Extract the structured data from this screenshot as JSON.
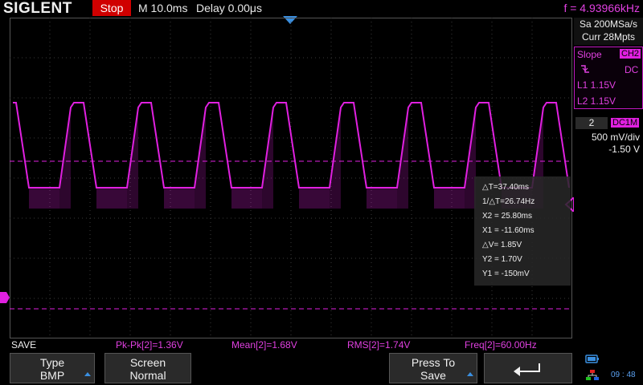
{
  "header": {
    "brand": "SIGLENT",
    "run_state": "Stop",
    "timebase": "M 10.0ms",
    "delay": "Delay 0.00μs",
    "frequency": "f = 4.93966kHz"
  },
  "acquisition": {
    "sample_rate": "Sa 200MSa/s",
    "memory": "Curr 28Mpts"
  },
  "trigger": {
    "title": "Slope",
    "source": "CH2",
    "coupling": "DC",
    "level1": "L1  1.15V",
    "level2": "L2  1.15V"
  },
  "channel": {
    "number": "2",
    "coupling": "DC1M",
    "scale": "500 mV/div",
    "offset": "-1.50 V"
  },
  "cursors": {
    "delta_t": "△T=37.40ms",
    "inv_delta_t": "1/△T=26.74Hz",
    "x2": "X2 = 25.80ms",
    "x1": "X1 = -11.60ms",
    "delta_v": "△V= 1.85V",
    "y2": "Y2 = 1.70V",
    "y1": "Y1 = -150mV"
  },
  "measurements": {
    "menu_title": "SAVE",
    "pkpk": "Pk-Pk[2]=1.36V",
    "mean": "Mean[2]=1.68V",
    "rms": "RMS[2]=1.74V",
    "freq": "Freq[2]=60.00Hz"
  },
  "softkeys": {
    "type_label": "Type",
    "type_value": "BMP",
    "screen_label": "Screen",
    "screen_value": "Normal",
    "press_label": "Press To",
    "press_value": "Save"
  },
  "status": {
    "clock": "09 : 48"
  },
  "colors": {
    "trace": "#e020e0",
    "grid": "#444444",
    "accent_blue": "#3a8fe0",
    "stop_red": "#d00000"
  }
}
